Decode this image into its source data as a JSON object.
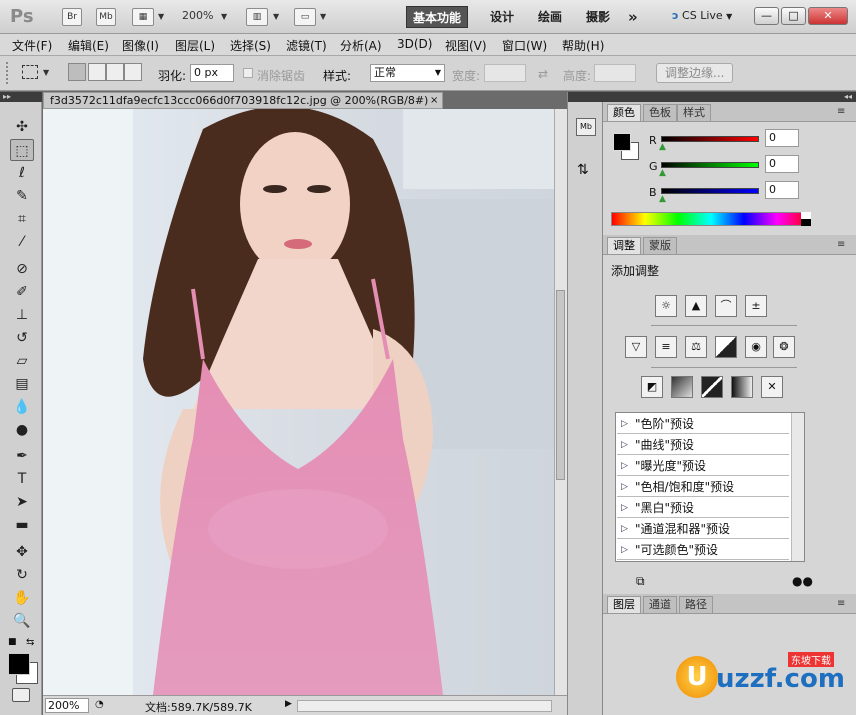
{
  "app": {
    "logo": "Ps",
    "bridge_icon": "Br",
    "minibridge_icon": "Mb",
    "zoom": "200%",
    "workspaces": [
      "基本功能",
      "设计",
      "绘画",
      "摄影"
    ],
    "more_workspaces": "»",
    "cs_live": "CS Live",
    "window_controls": {
      "minimize": "—",
      "restore": "□",
      "close": "✕"
    }
  },
  "menu": [
    "文件(F)",
    "编辑(E)",
    "图像(I)",
    "图层(L)",
    "选择(S)",
    "滤镜(T)",
    "分析(A)",
    "3D(D)",
    "视图(V)",
    "窗口(W)",
    "帮助(H)"
  ],
  "options": {
    "feather_label": "羽化:",
    "feather_value": "0 px",
    "antialias_label": "消除锯齿",
    "style_label": "样式:",
    "style_value": "正常",
    "width_label": "宽度:",
    "height_label": "高度:",
    "refine_edge": "调整边缘..."
  },
  "document": {
    "tab_title": "f3d3572c11dfa9ecfc13ccc066d0f703918fc12c.jpg @ 200%(RGB/8#)",
    "close": "×",
    "status_zoom": "200%",
    "status_doc": "文档:589.7K/589.7K"
  },
  "color_panel": {
    "tabs": [
      "颜色",
      "色板",
      "样式"
    ],
    "channels": [
      {
        "label": "R",
        "value": "0",
        "color": "#c00000"
      },
      {
        "label": "G",
        "value": "0",
        "color": "#00b000"
      },
      {
        "label": "B",
        "value": "0",
        "color": "#0000c0"
      }
    ]
  },
  "adjust_panel": {
    "tabs": [
      "调整",
      "蒙版"
    ],
    "title": "添加调整",
    "icons_row1": [
      "brightness-contrast-icon",
      "levels-icon",
      "curves-icon",
      "exposure-icon"
    ],
    "icons_row2": [
      "vibrance-icon",
      "hue-saturation-icon",
      "color-balance-icon",
      "black-white-icon",
      "photo-filter-icon",
      "channel-mixer-icon"
    ],
    "icons_row3": [
      "invert-icon",
      "posterize-icon",
      "threshold-icon",
      "gradient-map-icon",
      "selective-color-icon"
    ],
    "presets": [
      "\"色阶\"预设",
      "\"曲线\"预设",
      "\"曝光度\"预设",
      "\"色相/饱和度\"预设",
      "\"黑白\"预设",
      "\"通道混和器\"预设",
      "\"可选颜色\"预设"
    ]
  },
  "layers_panel": {
    "tabs": [
      "图层",
      "通道",
      "路径"
    ]
  },
  "watermark": "uzzf.com",
  "watermark_cn": "东坡下载"
}
